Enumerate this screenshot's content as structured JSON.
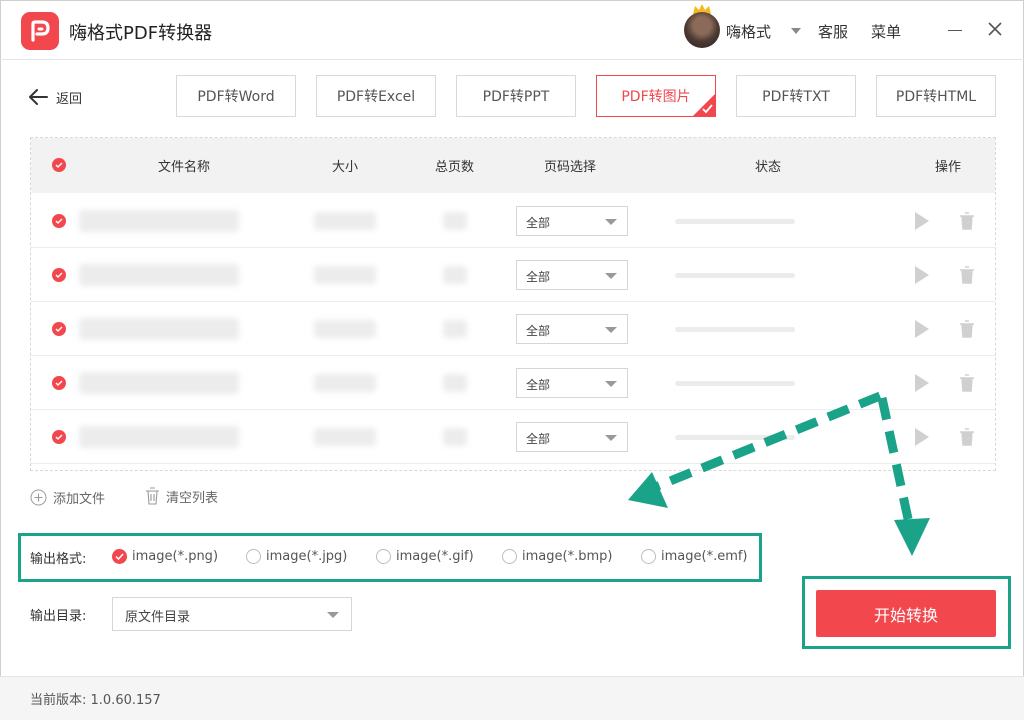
{
  "app": {
    "title": "嗨格式PDF转换器",
    "username": "嗨格式",
    "service": "客服",
    "menu": "菜单"
  },
  "nav": {
    "back_label": "返回",
    "tabs": [
      {
        "label": "PDF转Word",
        "active": false
      },
      {
        "label": "PDF转Excel",
        "active": false
      },
      {
        "label": "PDF转PPT",
        "active": false
      },
      {
        "label": "PDF转图片",
        "active": true
      },
      {
        "label": "PDF转TXT",
        "active": false
      },
      {
        "label": "PDF转HTML",
        "active": false
      }
    ]
  },
  "table": {
    "headers": {
      "name": "文件名称",
      "size": "大小",
      "pages": "总页数",
      "page_select": "页码选择",
      "status": "状态",
      "actions": "操作"
    },
    "rows": [
      {
        "checked": true,
        "page_select": "全部"
      },
      {
        "checked": true,
        "page_select": "全部"
      },
      {
        "checked": true,
        "page_select": "全部"
      },
      {
        "checked": true,
        "page_select": "全部"
      },
      {
        "checked": true,
        "page_select": "全部"
      }
    ]
  },
  "actions": {
    "add_file": "添加文件",
    "clear_list": "清空列表"
  },
  "output_format": {
    "label": "输出格式:",
    "options": [
      {
        "label": "image(*.png)",
        "selected": true
      },
      {
        "label": "image(*.jpg)",
        "selected": false
      },
      {
        "label": "image(*.gif)",
        "selected": false
      },
      {
        "label": "image(*.bmp)",
        "selected": false
      },
      {
        "label": "image(*.emf)",
        "selected": false
      }
    ]
  },
  "output_dir": {
    "label": "输出目录:",
    "value": "原文件目录"
  },
  "start_button": "开始转换",
  "footer": {
    "version_label": "当前版本: 1.0.60.157"
  },
  "colors": {
    "accent": "#f1474d",
    "highlight": "#1aa388"
  }
}
